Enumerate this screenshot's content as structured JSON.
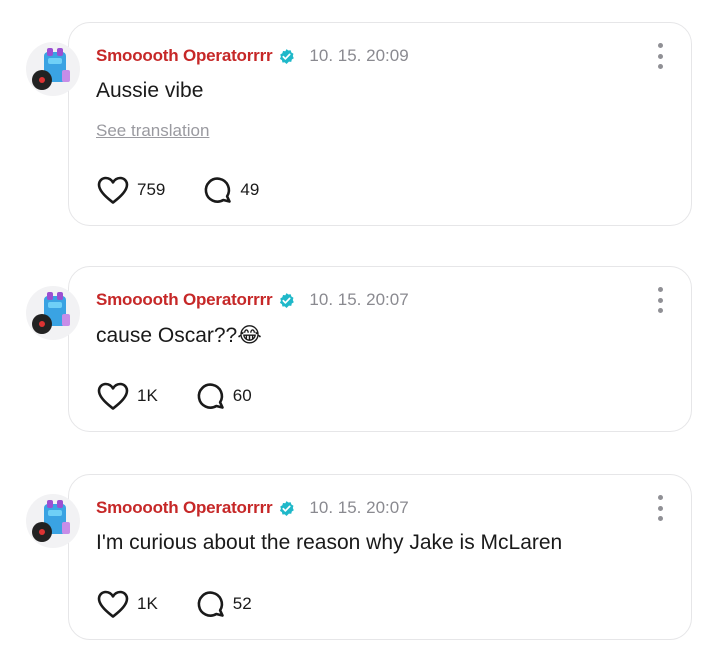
{
  "posts": [
    {
      "author": "Smooooth Operatorrrr",
      "timestamp": "10. 15. 20:09",
      "text": "Aussie vibe",
      "translate_label": "See translation",
      "likes": "759",
      "replies": "49"
    },
    {
      "author": "Smooooth Operatorrrr",
      "timestamp": "10. 15. 20:07",
      "text": "cause Oscar??😂",
      "likes": "1K",
      "replies": "60"
    },
    {
      "author": "Smooooth Operatorrrr",
      "timestamp": "10. 15. 20:07",
      "text": "I'm curious about the reason why Jake is McLaren",
      "likes": "1K",
      "replies": "52"
    }
  ],
  "colors": {
    "author": "#c62828",
    "verified_badge": "#1fb8c9",
    "muted": "#8a8a90",
    "card_border": "#e6e6e8"
  },
  "icons": {
    "verified": "verified-badge-icon",
    "like": "heart-icon",
    "reply": "speech-bubble-icon",
    "more": "vertical-ellipsis-icon"
  }
}
